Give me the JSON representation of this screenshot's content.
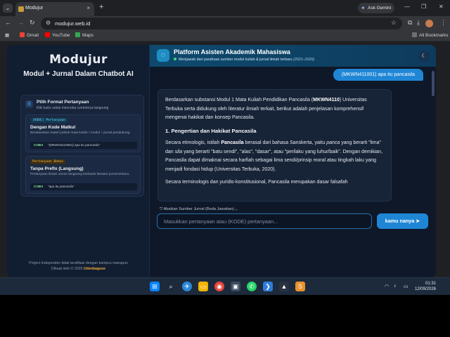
{
  "browser": {
    "tab_title": "Modujur",
    "tab_close": "×",
    "new_tab": "+",
    "gemini_label": "Ask Gemini",
    "url": "modujur.web.id",
    "bookmarks": [
      {
        "label": "Gmail",
        "color": "#ea4335"
      },
      {
        "label": "YouTube",
        "color": "#ff0000"
      },
      {
        "label": "Maps",
        "color": "#34a853"
      }
    ],
    "all_bookmarks": "All Bookmarks"
  },
  "sidebar": {
    "logo": "Modujur",
    "subtitle": "Modul + Jurnal Dalam Chatbot AI",
    "format_card": {
      "title": "Pilih Format Pertanyaan",
      "subtitle": "Klik kartu untuk mencoba contohnya langsung",
      "options": [
        {
          "tag": "[KODE] Pertanyaan",
          "title": "Dengan Kode Matkul",
          "desc": "Berdasarkan materi pokok mata kuliah / modul + jurnal pendukung.",
          "try_label": "COBA",
          "example": "\"(MKWN4110001) apa itu pancasila\""
        },
        {
          "tag": "Pertanyaan Bebas",
          "title": "Tanpa Prefix (Langsung)",
          "desc": "Pertanyaan ilmiah umum langsung berbasis literatur jurnal terbaru.",
          "try_label": "COBA",
          "example": "\"apa itu pancasila\""
        }
      ]
    },
    "footer_line1": "Project Independen tidak terafiliasi dengan kampus manapun",
    "footer_line2_prefix": "Dibuat oleh © 2026",
    "footer_author": "Udenbaguse"
  },
  "header": {
    "title": "Platform Asisten Akademik Mahasiswa",
    "subtitle": "Menjawab dari parafrase sumber modul kuliah & jurnal ilmiah terbaru",
    "years": "(2021–2026)"
  },
  "chat": {
    "user_message": "(MKWN411001) apa itu pancasila",
    "bot": {
      "intro_1": "Berdasarkan substansi Modul 1 Mata Kuliah Pendidikan Pancasila (",
      "intro_code": "MKWN4110",
      "intro_2": ") Universitas Terbuka serta didukung oleh literatur ilmiah terkait, berikut adalah penjelasan komprehensif mengenai hakikat dan konsep Pancasila.",
      "heading": "1. Pengertian dan Hakikat Pancasila",
      "p2_a": "Secara etimologis, istilah ",
      "p2_b": "Pancasila",
      "p2_c": " berasal dari bahasa Sanskerta, yaitu ",
      "p2_d": "panca",
      "p2_e": " yang berarti \"lima\" dan ",
      "p2_f": "sila",
      "p2_g": " yang berarti \"batu sendi\", \"alas\", \"dasar\", atau \"perilaku yang luhur/baik\". Dengan demikian, Pancasila dapat dimaknai secara harfiah sebagai lima sendi/prinsip moral atau tingkah laku yang menjadi fondasi hidup (Universitas Terbuka, 2020).",
      "p3": "Secara terminologis dan yuridis-konstitusional, Pancasila merupakan dasar falsafah"
    },
    "source_toggle": "Abaikan Sumber Jurnal (Beda Jawaban)",
    "input_placeholder": "Masukkan pertanyaan atau (KODE) pertanyaan...",
    "send_label": "kamu nanya"
  },
  "taskbar": {
    "time": "01:31",
    "date": "12/09/2026"
  }
}
